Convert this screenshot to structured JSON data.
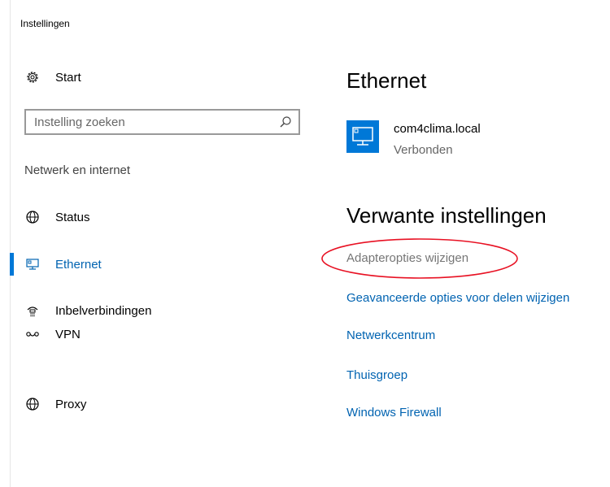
{
  "window": {
    "title": "Instellingen"
  },
  "sidebar": {
    "home": {
      "label": "Start",
      "icon": "gear-icon"
    },
    "search": {
      "placeholder": "Instelling zoeken",
      "value": "",
      "icon": "search-icon"
    },
    "section_label": "Netwerk en internet",
    "items": [
      {
        "label": "Status",
        "icon": "globe-status-icon",
        "selected": false
      },
      {
        "label": "Ethernet",
        "icon": "ethernet-icon",
        "selected": true
      },
      {
        "label": "Inbelverbindingen",
        "icon": "dialup-icon",
        "selected": false
      },
      {
        "label": "VPN",
        "icon": "vpn-icon",
        "selected": false
      },
      {
        "label": "Proxy",
        "icon": "globe-icon",
        "selected": false
      }
    ]
  },
  "main": {
    "title": "Ethernet",
    "network": {
      "name": "com4clima.local",
      "status": "Verbonden",
      "icon": "ethernet-monitor-icon"
    },
    "related": {
      "heading": "Verwante instellingen",
      "links": [
        {
          "label": "Adapteropties wijzigen",
          "highlighted": true
        },
        {
          "label": "Geavanceerde opties voor delen wijzigen"
        },
        {
          "label": "Netwerkcentrum"
        },
        {
          "label": "Thuisgroep"
        },
        {
          "label": "Windows Firewall"
        }
      ]
    }
  },
  "colors": {
    "accent": "#0078d7",
    "link": "#0063b1",
    "annotation": "#e81123"
  }
}
